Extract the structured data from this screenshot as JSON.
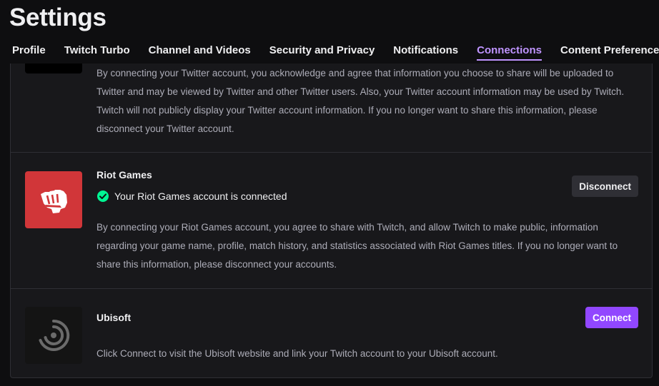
{
  "page": {
    "title": "Settings"
  },
  "tabs": [
    {
      "label": "Profile"
    },
    {
      "label": "Twitch Turbo"
    },
    {
      "label": "Channel and Videos"
    },
    {
      "label": "Security and Privacy"
    },
    {
      "label": "Notifications"
    },
    {
      "label": "Connections",
      "active": true
    },
    {
      "label": "Content Preferences"
    }
  ],
  "connections": {
    "twitter": {
      "description": "By connecting your Twitter account, you acknowledge and agree that information you choose to share will be uploaded to Twitter and may be viewed by Twitter and other Twitter users. Also, your Twitter account information may be used by Twitch. Twitch will not publicly display your Twitter account information. If you no longer want to share this information, please disconnect your Twitter account."
    },
    "riot": {
      "name": "Riot Games",
      "status": "Your Riot Games account is connected",
      "button_label": "Disconnect",
      "description": "By connecting your Riot Games account, you agree to share with Twitch, and allow Twitch to make public, information regarding your game name, profile, match history, and statistics associated with Riot Games titles. If you no longer want to share this information, please disconnect your accounts.",
      "logo_color": "#d13639"
    },
    "ubisoft": {
      "name": "Ubisoft",
      "button_label": "Connect",
      "description": "Click Connect to visit the Ubisoft website and link your Twitch account to your Ubisoft account."
    }
  },
  "colors": {
    "accent": "#bf94ff",
    "primary_button": "#9147ff",
    "success": "#00f593"
  }
}
